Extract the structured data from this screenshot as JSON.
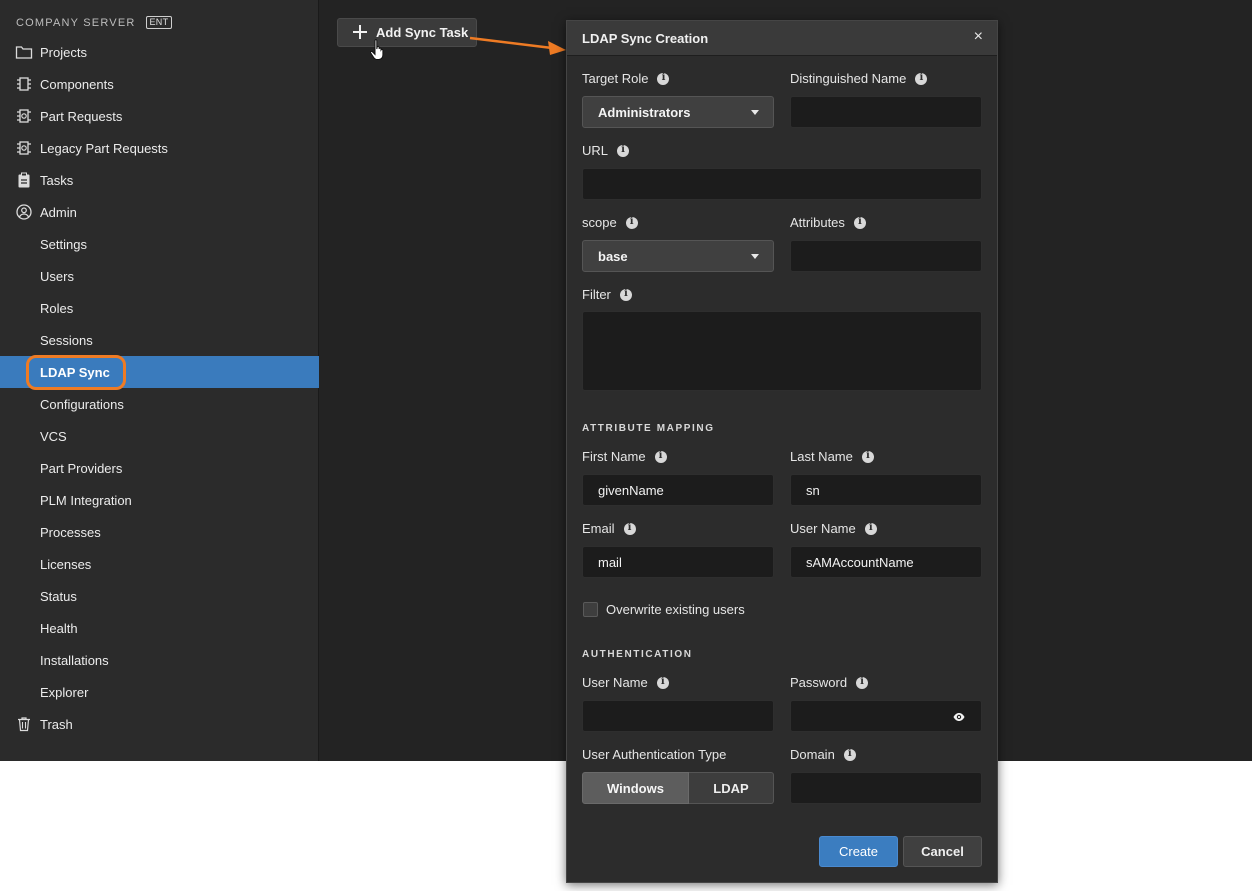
{
  "sidebar": {
    "server_title": "COMPANY SERVER",
    "badge": "ENT",
    "items": [
      {
        "label": "Projects",
        "icon": "folder-icon"
      },
      {
        "label": "Components",
        "icon": "chip-icon"
      },
      {
        "label": "Part Requests",
        "icon": "part-request-icon"
      },
      {
        "label": "Legacy Part Requests",
        "icon": "part-request-icon"
      },
      {
        "label": "Tasks",
        "icon": "clipboard-icon"
      },
      {
        "label": "Admin",
        "icon": "user-circle-icon"
      },
      {
        "label": "Settings"
      },
      {
        "label": "Users"
      },
      {
        "label": "Roles"
      },
      {
        "label": "Sessions"
      },
      {
        "label": "LDAP Sync",
        "active": true
      },
      {
        "label": "Configurations"
      },
      {
        "label": "VCS"
      },
      {
        "label": "Part Providers"
      },
      {
        "label": "PLM Integration"
      },
      {
        "label": "Processes"
      },
      {
        "label": "Licenses"
      },
      {
        "label": "Status"
      },
      {
        "label": "Health"
      },
      {
        "label": "Installations"
      },
      {
        "label": "Explorer"
      },
      {
        "label": "Trash",
        "icon": "trash-icon"
      }
    ]
  },
  "toolbar": {
    "add_label": "Add Sync Task"
  },
  "modal": {
    "title": "LDAP Sync Creation",
    "close_glyph": "×",
    "target_role": {
      "label": "Target Role",
      "value": "Administrators"
    },
    "distinguished_name": {
      "label": "Distinguished Name",
      "value": ""
    },
    "url": {
      "label": "URL",
      "value": ""
    },
    "scope": {
      "label": "scope",
      "value": "base"
    },
    "attributes": {
      "label": "Attributes",
      "value": ""
    },
    "filter": {
      "label": "Filter",
      "value": ""
    },
    "attribute_mapping": {
      "title": "ATTRIBUTE MAPPING",
      "first_name": {
        "label": "First Name",
        "value": "givenName"
      },
      "last_name": {
        "label": "Last Name",
        "value": "sn"
      },
      "email": {
        "label": "Email",
        "value": "mail"
      },
      "user_name": {
        "label": "User Name",
        "value": "sAMAccountName"
      }
    },
    "overwrite": {
      "label": "Overwrite existing users",
      "checked": false
    },
    "authentication": {
      "title": "AUTHENTICATION",
      "user_name": {
        "label": "User Name",
        "value": ""
      },
      "password": {
        "label": "Password",
        "value": ""
      },
      "auth_type": {
        "label": "User Authentication Type",
        "options": [
          "Windows",
          "LDAP"
        ],
        "selected": "Windows"
      },
      "domain": {
        "label": "Domain",
        "value": ""
      }
    },
    "buttons": {
      "create": "Create",
      "cancel": "Cancel"
    }
  },
  "colors": {
    "accent": "#3a7bbd",
    "highlight": "#ee7b24",
    "background": "#232323",
    "sidebar": "#2b2b2b"
  }
}
